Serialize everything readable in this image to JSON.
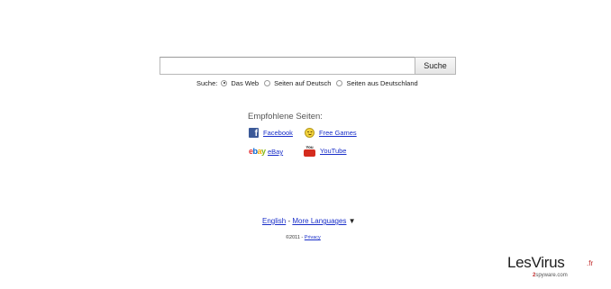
{
  "search": {
    "value": "",
    "button_label": "Suche"
  },
  "scope": {
    "label": "Suche:",
    "options": [
      {
        "label": "Das Web",
        "checked": true
      },
      {
        "label": "Seiten auf Deutsch",
        "checked": false
      },
      {
        "label": "Seiten aus Deutschland",
        "checked": false
      }
    ]
  },
  "recommended": {
    "title": "Empfohlene Seiten:",
    "links": [
      {
        "label": "Facebook",
        "icon": "facebook-icon"
      },
      {
        "label": "Free Games",
        "icon": "smiley-icon"
      },
      {
        "label": "eBay",
        "icon": "ebay-icon"
      },
      {
        "label": "YouTube",
        "icon": "youtube-icon"
      }
    ]
  },
  "footer": {
    "english": "English",
    "separator": "-",
    "more_languages": "More Languages",
    "arrow": "▼",
    "copyright": "©2011 -",
    "privacy": "Privacy"
  },
  "watermark": {
    "brand": "LesVirus",
    "tld": ".fr",
    "sub_num": "2",
    "sub_text": "spyware.com",
    "logo_colors": {
      "main": "#1d1d1d",
      "accent": "#c12a2a"
    }
  },
  "colors": {
    "link": "#1a2fc9",
    "background": "#ffffff"
  }
}
